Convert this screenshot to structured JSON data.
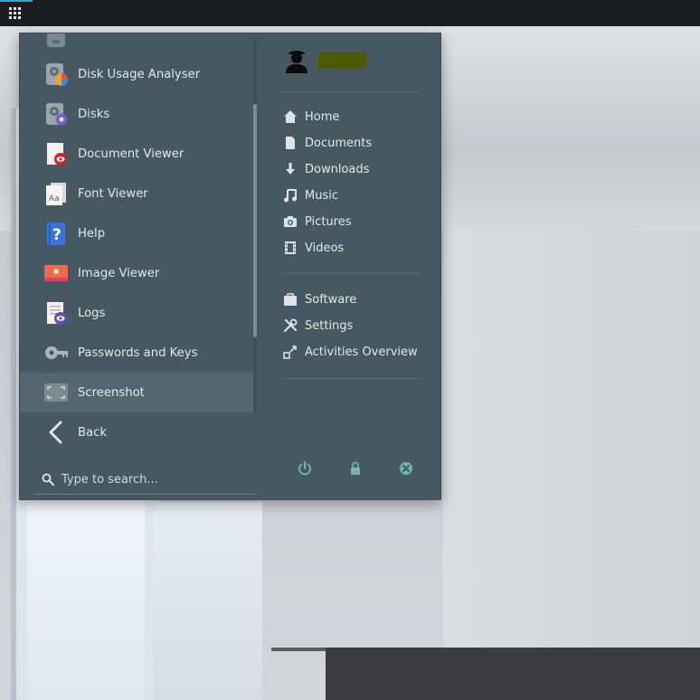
{
  "colors": {
    "menu_bg": "#465861",
    "highlight_bg": "#536770",
    "text": "#e3e8ea",
    "accent_teal": "#6fb5b1",
    "topbar_bg": "#1a1d21",
    "topbar_accent": "#2ea7d6"
  },
  "topbar": {
    "apps_icon": "apps-grid-icon"
  },
  "apps": [
    {
      "label": "Disk Usage Analyser",
      "icon": "disk-usage-analyser-icon"
    },
    {
      "label": "Disks",
      "icon": "disks-icon"
    },
    {
      "label": "Document Viewer",
      "icon": "document-viewer-icon"
    },
    {
      "label": "Font Viewer",
      "icon": "font-viewer-icon"
    },
    {
      "label": "Help",
      "icon": "help-icon"
    },
    {
      "label": "Image Viewer",
      "icon": "image-viewer-icon"
    },
    {
      "label": "Logs",
      "icon": "logs-icon"
    },
    {
      "label": "Passwords and Keys",
      "icon": "passwords-and-keys-icon"
    },
    {
      "label": "Screenshot",
      "icon": "screenshot-icon",
      "highlighted": true
    }
  ],
  "back": {
    "label": "Back",
    "icon": "chevron-left-icon"
  },
  "search": {
    "placeholder": "Type to search...",
    "value": "",
    "icon": "search-icon"
  },
  "user": {
    "avatar_icon": "user-avatar-icon"
  },
  "places": [
    {
      "label": "Home",
      "icon": "home-icon"
    },
    {
      "label": "Documents",
      "icon": "document-icon"
    },
    {
      "label": "Downloads",
      "icon": "download-icon"
    },
    {
      "label": "Music",
      "icon": "music-icon"
    },
    {
      "label": "Pictures",
      "icon": "camera-icon"
    },
    {
      "label": "Videos",
      "icon": "film-icon"
    }
  ],
  "system": [
    {
      "label": "Software",
      "icon": "software-bag-icon"
    },
    {
      "label": "Settings",
      "icon": "settings-tools-icon"
    },
    {
      "label": "Activities Overview",
      "icon": "activities-overview-icon"
    }
  ],
  "session_buttons": [
    {
      "name": "power-button",
      "icon": "power-icon"
    },
    {
      "name": "lock-button",
      "icon": "lock-icon"
    },
    {
      "name": "logout-button",
      "icon": "logout-icon"
    }
  ]
}
